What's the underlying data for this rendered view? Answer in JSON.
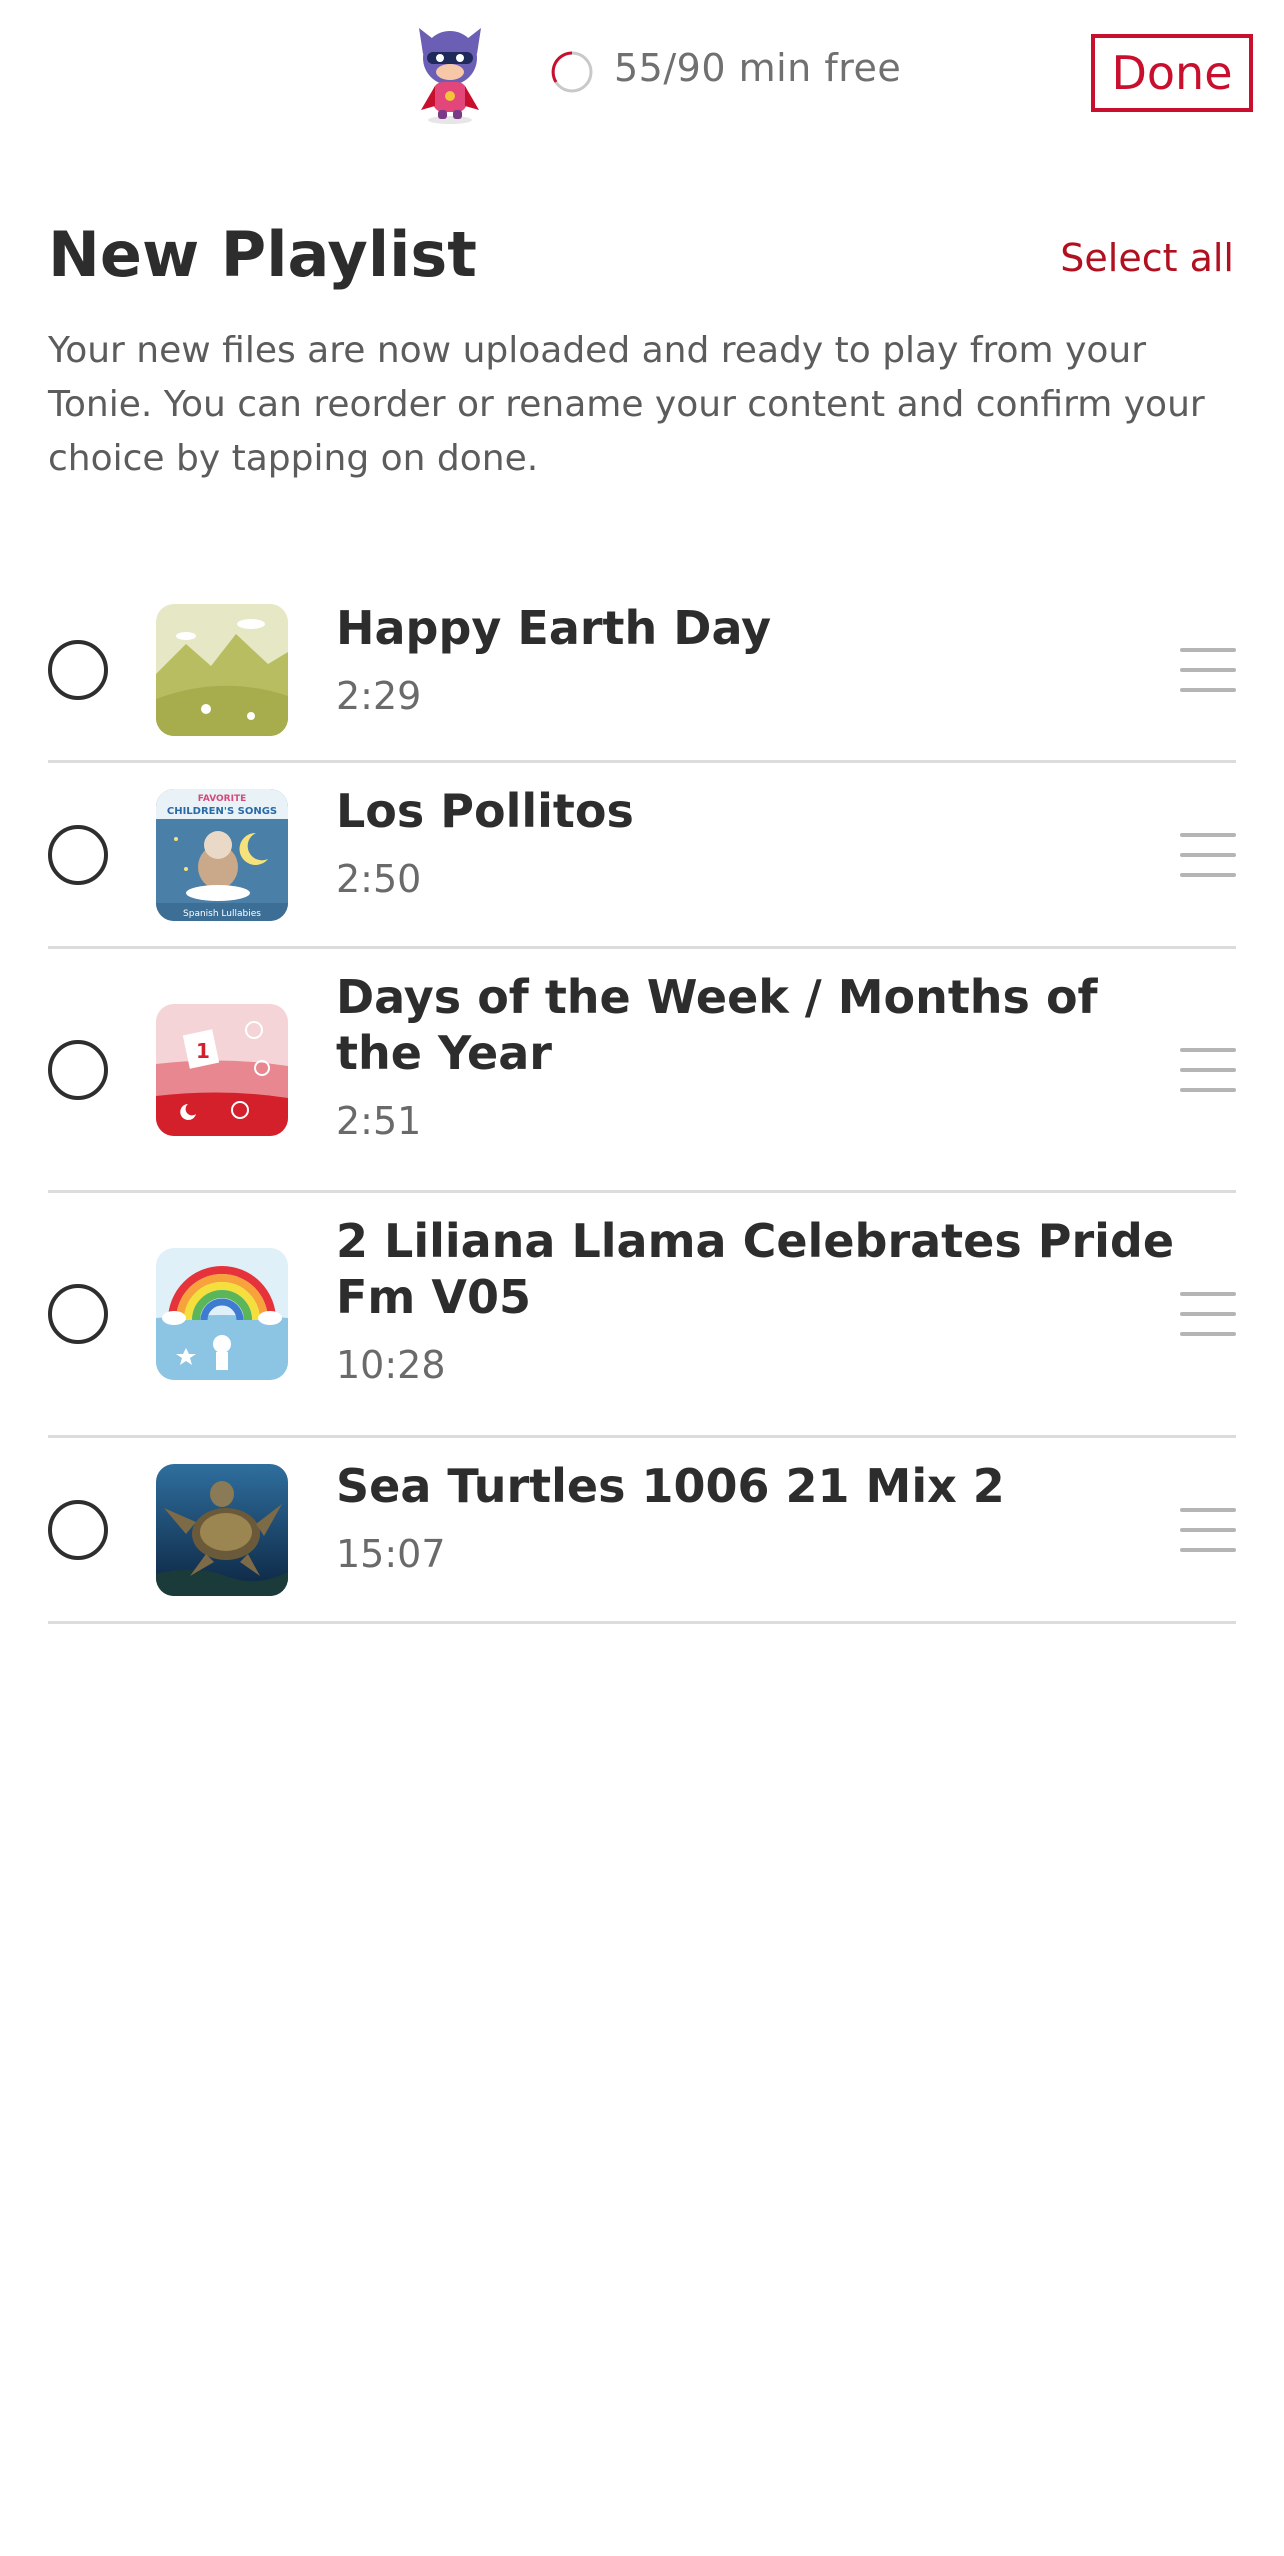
{
  "header": {
    "time_free": "55/90 min free",
    "done_label": "Done"
  },
  "page": {
    "title": "New Playlist",
    "select_all": "Select all",
    "description": "Your new files are now uploaded and ready to play from your Tonie. You can reorder or rename your content and confirm your choice by tapping on done."
  },
  "tracks": [
    {
      "title": "Happy Earth Day",
      "duration": "2:29",
      "icon": "earth-day-artwork"
    },
    {
      "title": "Los Pollitos",
      "duration": "2:50",
      "icon": "spanish-lullabies-artwork",
      "artwork_text": [
        "FAVORITE",
        "CHILDREN'S SONGS",
        "Spanish Lullabies"
      ]
    },
    {
      "title": "Days of the Week / Months of the Year",
      "duration": "2:51",
      "icon": "calendar-artwork",
      "artwork_text": [
        "1"
      ]
    },
    {
      "title": "2 Liliana Llama Celebrates Pride Fm V05",
      "duration": "10:28",
      "icon": "rainbow-artwork"
    },
    {
      "title": "Sea Turtles 1006 21 Mix 2",
      "duration": "15:07",
      "icon": "sea-turtle-photo"
    }
  ],
  "colors": {
    "accent": "#c8102e",
    "title_text": "#2d2d2d",
    "secondary_text": "#6a6a6a",
    "divider": "#dcdcdc"
  }
}
